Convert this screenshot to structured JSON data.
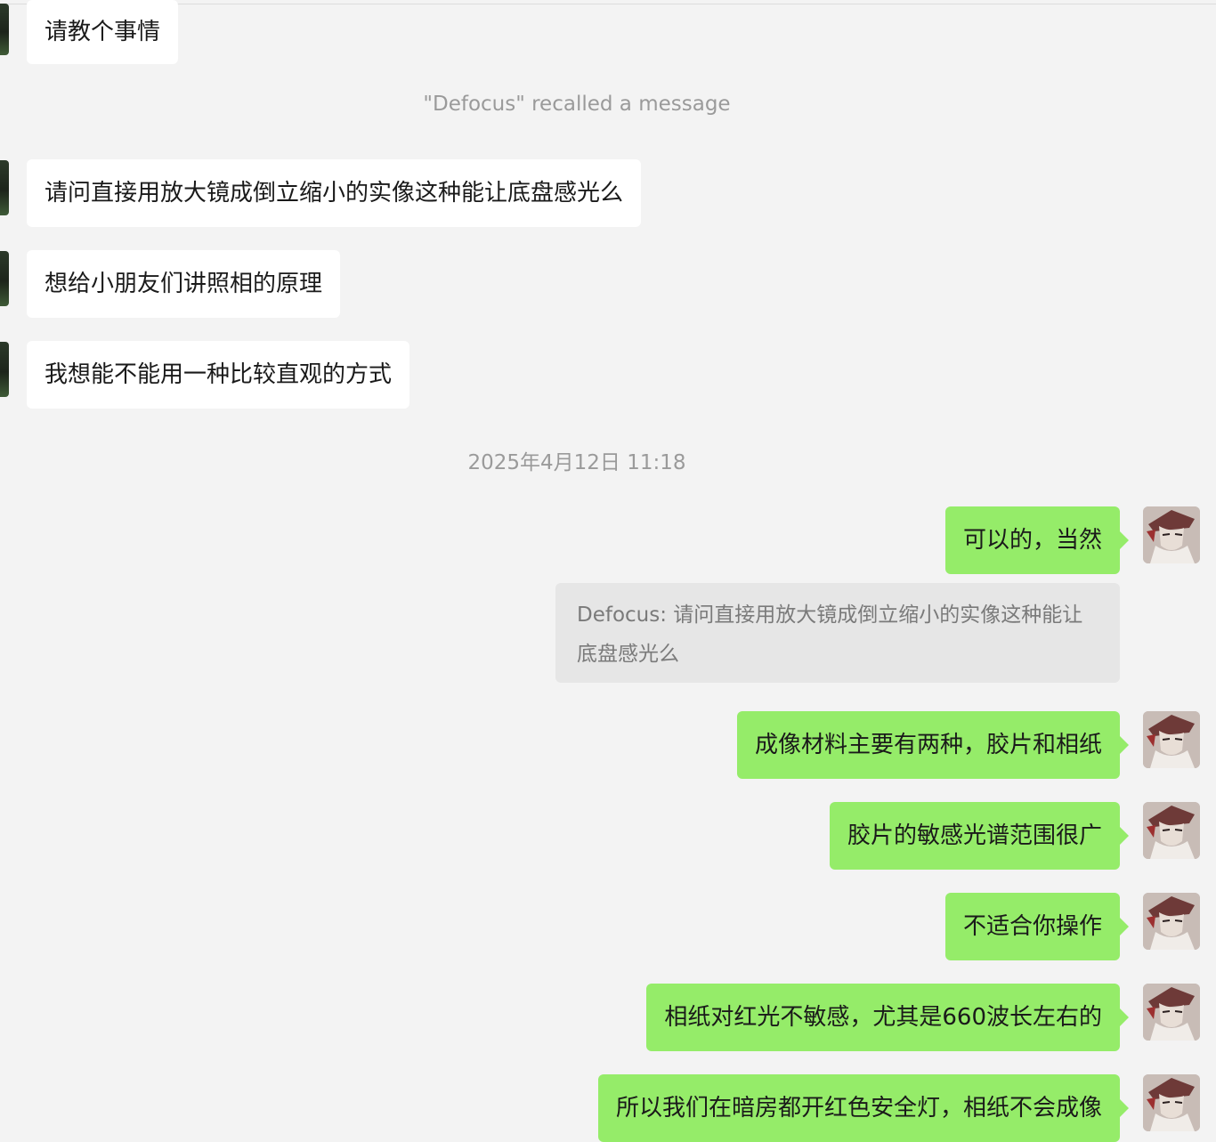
{
  "incoming_messages": [
    {
      "text": "请教个事情"
    },
    {
      "text": "请问直接用放大镜成倒立缩小的实像这种能让底盘感光么"
    },
    {
      "text": "想给小朋友们讲照相的原理"
    },
    {
      "text": "我想能不能用一种比较直观的方式"
    }
  ],
  "system": {
    "recalled": "\"Defocus\" recalled a message",
    "timestamp": "2025年4月12日 11:18"
  },
  "outgoing_messages": [
    {
      "text": "可以的，当然"
    },
    {
      "text": "成像材料主要有两种，胶片和相纸"
    },
    {
      "text": "胶片的敏感光谱范围很广"
    },
    {
      "text": "不适合你操作"
    },
    {
      "text": "相纸对红光不敏感，尤其是660波长左右的"
    },
    {
      "text": "所以我们在暗房都开红色安全灯，相纸不会成像"
    }
  ],
  "quote": {
    "text": "Defocus: 请问直接用放大镜成倒立缩小的实像这种能让底盘感光么"
  },
  "colors": {
    "background": "#f3f3f3",
    "incoming_bubble": "#ffffff",
    "outgoing_bubble": "#95ec69",
    "system_text": "#9a9a9a",
    "quote_bg": "#e6e6e6"
  },
  "icons": {
    "incoming_avatar": "contact-avatar-icon",
    "outgoing_avatar": "my-avatar-icon"
  }
}
